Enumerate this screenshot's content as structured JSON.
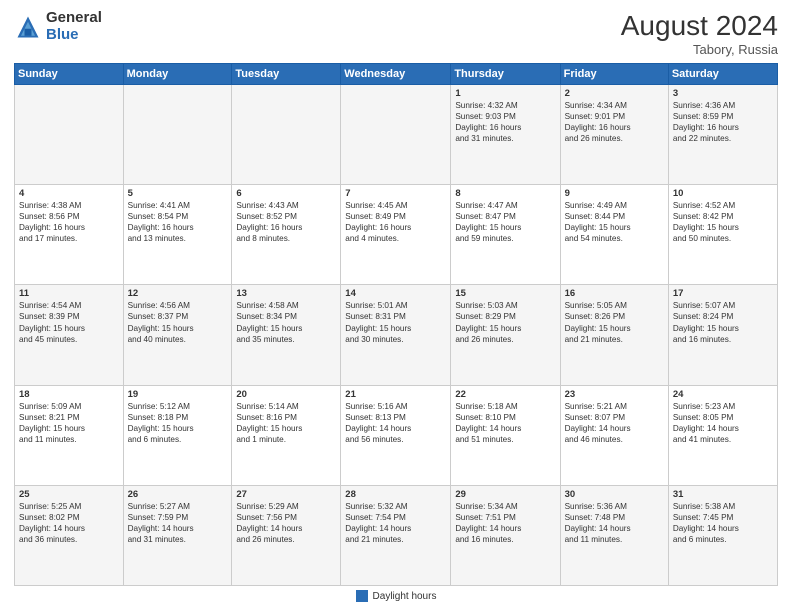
{
  "header": {
    "logo_general": "General",
    "logo_blue": "Blue",
    "month_year": "August 2024",
    "location": "Tabory, Russia"
  },
  "legend": {
    "label": "Daylight hours"
  },
  "days_header": [
    "Sunday",
    "Monday",
    "Tuesday",
    "Wednesday",
    "Thursday",
    "Friday",
    "Saturday"
  ],
  "weeks": [
    [
      {
        "num": "",
        "info": ""
      },
      {
        "num": "",
        "info": ""
      },
      {
        "num": "",
        "info": ""
      },
      {
        "num": "",
        "info": ""
      },
      {
        "num": "1",
        "info": "Sunrise: 4:32 AM\nSunset: 9:03 PM\nDaylight: 16 hours\nand 31 minutes."
      },
      {
        "num": "2",
        "info": "Sunrise: 4:34 AM\nSunset: 9:01 PM\nDaylight: 16 hours\nand 26 minutes."
      },
      {
        "num": "3",
        "info": "Sunrise: 4:36 AM\nSunset: 8:59 PM\nDaylight: 16 hours\nand 22 minutes."
      }
    ],
    [
      {
        "num": "4",
        "info": "Sunrise: 4:38 AM\nSunset: 8:56 PM\nDaylight: 16 hours\nand 17 minutes."
      },
      {
        "num": "5",
        "info": "Sunrise: 4:41 AM\nSunset: 8:54 PM\nDaylight: 16 hours\nand 13 minutes."
      },
      {
        "num": "6",
        "info": "Sunrise: 4:43 AM\nSunset: 8:52 PM\nDaylight: 16 hours\nand 8 minutes."
      },
      {
        "num": "7",
        "info": "Sunrise: 4:45 AM\nSunset: 8:49 PM\nDaylight: 16 hours\nand 4 minutes."
      },
      {
        "num": "8",
        "info": "Sunrise: 4:47 AM\nSunset: 8:47 PM\nDaylight: 15 hours\nand 59 minutes."
      },
      {
        "num": "9",
        "info": "Sunrise: 4:49 AM\nSunset: 8:44 PM\nDaylight: 15 hours\nand 54 minutes."
      },
      {
        "num": "10",
        "info": "Sunrise: 4:52 AM\nSunset: 8:42 PM\nDaylight: 15 hours\nand 50 minutes."
      }
    ],
    [
      {
        "num": "11",
        "info": "Sunrise: 4:54 AM\nSunset: 8:39 PM\nDaylight: 15 hours\nand 45 minutes."
      },
      {
        "num": "12",
        "info": "Sunrise: 4:56 AM\nSunset: 8:37 PM\nDaylight: 15 hours\nand 40 minutes."
      },
      {
        "num": "13",
        "info": "Sunrise: 4:58 AM\nSunset: 8:34 PM\nDaylight: 15 hours\nand 35 minutes."
      },
      {
        "num": "14",
        "info": "Sunrise: 5:01 AM\nSunset: 8:31 PM\nDaylight: 15 hours\nand 30 minutes."
      },
      {
        "num": "15",
        "info": "Sunrise: 5:03 AM\nSunset: 8:29 PM\nDaylight: 15 hours\nand 26 minutes."
      },
      {
        "num": "16",
        "info": "Sunrise: 5:05 AM\nSunset: 8:26 PM\nDaylight: 15 hours\nand 21 minutes."
      },
      {
        "num": "17",
        "info": "Sunrise: 5:07 AM\nSunset: 8:24 PM\nDaylight: 15 hours\nand 16 minutes."
      }
    ],
    [
      {
        "num": "18",
        "info": "Sunrise: 5:09 AM\nSunset: 8:21 PM\nDaylight: 15 hours\nand 11 minutes."
      },
      {
        "num": "19",
        "info": "Sunrise: 5:12 AM\nSunset: 8:18 PM\nDaylight: 15 hours\nand 6 minutes."
      },
      {
        "num": "20",
        "info": "Sunrise: 5:14 AM\nSunset: 8:16 PM\nDaylight: 15 hours\nand 1 minute."
      },
      {
        "num": "21",
        "info": "Sunrise: 5:16 AM\nSunset: 8:13 PM\nDaylight: 14 hours\nand 56 minutes."
      },
      {
        "num": "22",
        "info": "Sunrise: 5:18 AM\nSunset: 8:10 PM\nDaylight: 14 hours\nand 51 minutes."
      },
      {
        "num": "23",
        "info": "Sunrise: 5:21 AM\nSunset: 8:07 PM\nDaylight: 14 hours\nand 46 minutes."
      },
      {
        "num": "24",
        "info": "Sunrise: 5:23 AM\nSunset: 8:05 PM\nDaylight: 14 hours\nand 41 minutes."
      }
    ],
    [
      {
        "num": "25",
        "info": "Sunrise: 5:25 AM\nSunset: 8:02 PM\nDaylight: 14 hours\nand 36 minutes."
      },
      {
        "num": "26",
        "info": "Sunrise: 5:27 AM\nSunset: 7:59 PM\nDaylight: 14 hours\nand 31 minutes."
      },
      {
        "num": "27",
        "info": "Sunrise: 5:29 AM\nSunset: 7:56 PM\nDaylight: 14 hours\nand 26 minutes."
      },
      {
        "num": "28",
        "info": "Sunrise: 5:32 AM\nSunset: 7:54 PM\nDaylight: 14 hours\nand 21 minutes."
      },
      {
        "num": "29",
        "info": "Sunrise: 5:34 AM\nSunset: 7:51 PM\nDaylight: 14 hours\nand 16 minutes."
      },
      {
        "num": "30",
        "info": "Sunrise: 5:36 AM\nSunset: 7:48 PM\nDaylight: 14 hours\nand 11 minutes."
      },
      {
        "num": "31",
        "info": "Sunrise: 5:38 AM\nSunset: 7:45 PM\nDaylight: 14 hours\nand 6 minutes."
      }
    ]
  ]
}
